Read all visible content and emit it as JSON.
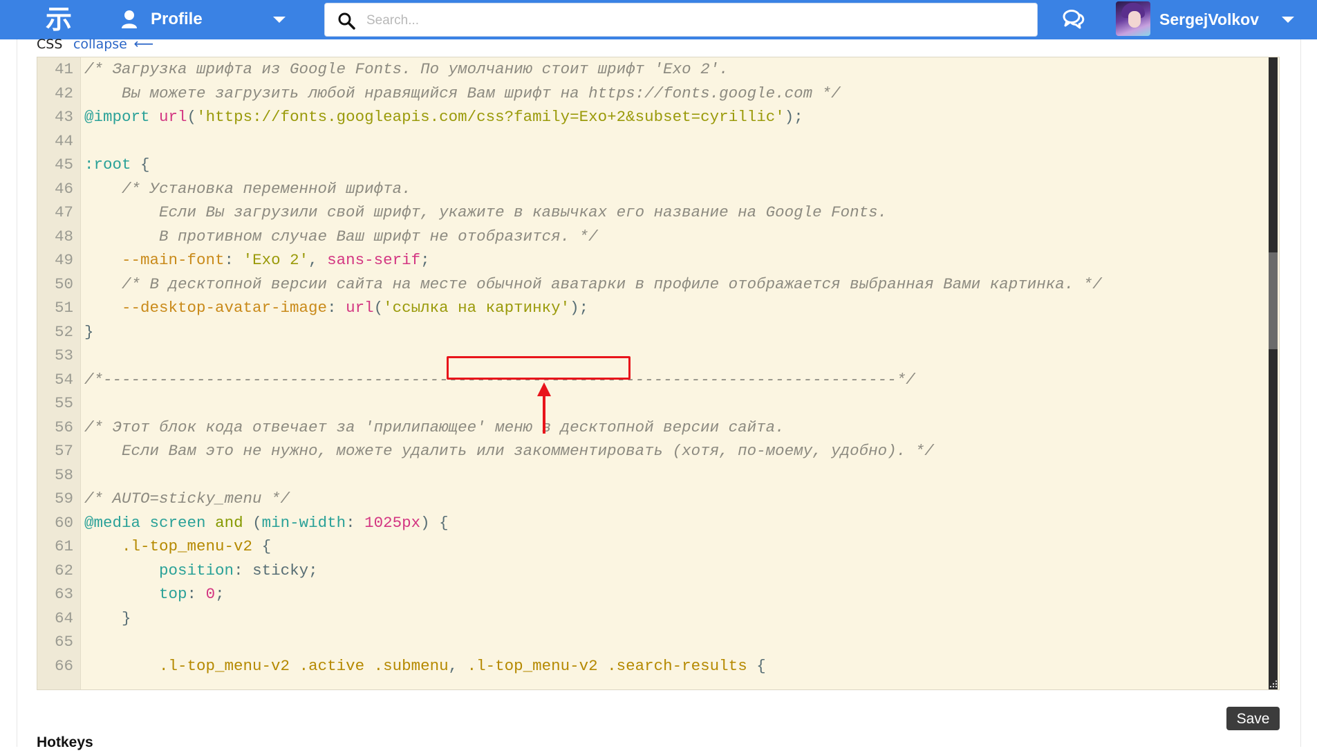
{
  "header": {
    "logo_glyph": "示",
    "profile_label": "Profile",
    "search_placeholder": "Search...",
    "username": "SergejVolkov",
    "brand_color": "#3a82e4"
  },
  "section": {
    "title": "CSS",
    "collapse_label": "collapse",
    "collapse_arrow": "⟵"
  },
  "editor": {
    "theme": "solarized-light",
    "highlight_color": "#e8141b",
    "lines": [
      {
        "n": "41",
        "html": "<span class=\"c-cm\">/* Загрузка шрифта из Google Fonts. По умолчанию стоит шрифт 'Exo 2'.</span>"
      },
      {
        "n": "42",
        "html": "<span class=\"c-cm\">    Вы можете загрузить любой нравящийся Вам шрифт на https://fonts.google.com */</span>"
      },
      {
        "n": "43",
        "html": "<span class=\"c-at\">@import</span> <span class=\"c-fn\">url</span><span class=\"c-p\">(</span><span class=\"c-st\">'https://fonts.googleapis.com/css?family=Exo+2&amp;subset=cyrillic'</span><span class=\"c-p\">);</span>"
      },
      {
        "n": "44",
        "html": ""
      },
      {
        "n": "45",
        "html": "<span class=\"c-at\">:root</span> <span class=\"c-p\">{</span>"
      },
      {
        "n": "46",
        "html": "    <span class=\"c-cm\">/* Установка переменной шрифта.</span>"
      },
      {
        "n": "47",
        "html": "<span class=\"c-cm\">        Если Вы загрузили свой шрифт, укажите в кавычках его название на Google Fonts.</span>"
      },
      {
        "n": "48",
        "html": "<span class=\"c-cm\">        В противном случае Ваш шрифт не отобразится. */</span>"
      },
      {
        "n": "49",
        "html": "    <span class=\"c-var\">--main-font</span><span class=\"c-p\">: </span><span class=\"c-st\">'Exo 2'</span><span class=\"c-p\">, </span><span class=\"c-fn\">sans-serif</span><span class=\"c-p\">;</span>"
      },
      {
        "n": "50",
        "html": "    <span class=\"c-cm\">/* В десктопной версии сайта на месте обычной аватарки в профиле отображается выбранная Вами картинка. */</span>"
      },
      {
        "n": "51",
        "html": "    <span class=\"c-var\">--desktop-avatar-image</span><span class=\"c-p\">: </span><span class=\"c-fn\">url</span><span class=\"c-p\">(</span><span class=\"c-st\">'ссылка на картинку'</span><span class=\"c-p\">);</span>"
      },
      {
        "n": "52",
        "html": "<span class=\"c-p\">}</span>"
      },
      {
        "n": "53",
        "html": ""
      },
      {
        "n": "54",
        "html": "<span class=\"c-cm\">/*-------------------------------------------------------------------------------------*/</span>"
      },
      {
        "n": "55",
        "html": ""
      },
      {
        "n": "56",
        "html": "<span class=\"c-cm\">/* Этот блок кода отвечает за 'прилипающее' меню в десктопной версии сайта.</span>"
      },
      {
        "n": "57",
        "html": "<span class=\"c-cm\">    Если Вам это не нужно, можете удалить или закомментировать (хотя, по-моему, удобно). */</span>"
      },
      {
        "n": "58",
        "html": ""
      },
      {
        "n": "59",
        "html": "<span class=\"c-cm\">/* AUTO=sticky_menu */</span>"
      },
      {
        "n": "60",
        "html": "<span class=\"c-at\">@media</span> <span class=\"c-prop\">screen</span> <span class=\"c-kw\">and</span> <span class=\"c-p\">(</span><span class=\"c-prop\">min-width</span><span class=\"c-p\">: </span><span class=\"c-num\">1025px</span><span class=\"c-p\">) {</span>"
      },
      {
        "n": "61",
        "html": "    <span class=\"c-sel\">.l-top_menu-v2</span> <span class=\"c-p\">{</span>"
      },
      {
        "n": "62",
        "html": "        <span class=\"c-prop\">position</span><span class=\"c-p\">: sticky;</span>"
      },
      {
        "n": "63",
        "html": "        <span class=\"c-prop\">top</span><span class=\"c-p\">: </span><span class=\"c-num\">0</span><span class=\"c-p\">;</span>"
      },
      {
        "n": "64",
        "html": "    <span class=\"c-p\">}</span>"
      },
      {
        "n": "65",
        "html": ""
      },
      {
        "n": "66",
        "html": "        <span class=\"c-sel\">.l-top_menu-v2 .active .submenu</span><span class=\"c-p\">, </span><span class=\"c-sel\">.l-top_menu-v2 .search-results</span> <span class=\"c-p\">{</span>"
      }
    ]
  },
  "footer": {
    "save_label": "Save",
    "hotkeys_title": "Hotkeys"
  }
}
